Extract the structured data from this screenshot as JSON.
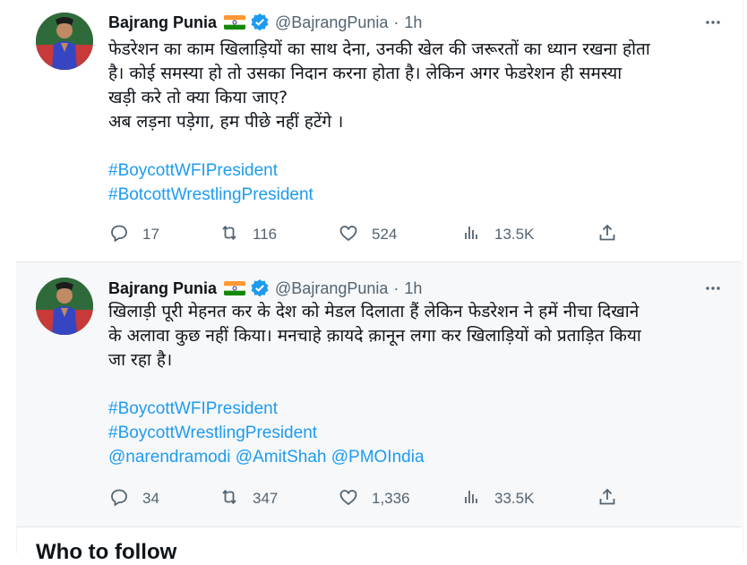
{
  "tweets": [
    {
      "author": "Bajrang Punia",
      "handle": "@BajrangPunia",
      "time": "1h",
      "text_lines": [
        "फेडरेशन का काम खिलाड़ियों का साथ देना, उनकी खेल की जरूरतों का ध्यान रखना होता",
        "है। कोई समस्या हो तो उसका निदान करना होता है। लेकिन अगर फेडरेशन ही समस्या",
        "खड़ी करे तो क्या किया जाए?",
        "अब लड़ना पड़ेगा, हम पीछे नहीं हटेंगे ।"
      ],
      "hashtags": [
        "#BoycottWFIPresident",
        "#BotcottWrestlingPresident"
      ],
      "replies": "17",
      "retweets": "116",
      "likes": "524",
      "views": "13.5K"
    },
    {
      "author": "Bajrang Punia",
      "handle": "@BajrangPunia",
      "time": "1h",
      "text_lines": [
        "खिलाड़ी पूरी मेहनत कर के देश को मेडल दिलाता हैं लेकिन फेडरेशन ने हमें नीचा दिखाने",
        "के अलावा कुछ नहीं किया। मनचाहे क़ायदे क़ानून लगा कर खिलाड़ियों को प्रताड़ित किया",
        "जा रहा है।"
      ],
      "hashtags": [
        "#BoycottWFIPresident",
        "#BoycottWrestlingPresident"
      ],
      "mentions": "@narendramodi @AmitShah @PMOIndia",
      "replies": "34",
      "retweets": "347",
      "likes": "1,336",
      "views": "33.5K"
    }
  ],
  "who_to_follow": "Who to follow",
  "icons": [
    "more-icon",
    "reply-icon",
    "retweet-icon",
    "like-icon",
    "views-icon",
    "share-icon",
    "verified-icon",
    "india-flag-icon"
  ],
  "colors": {
    "accent": "#1d9bf0",
    "secondary_text": "#536471"
  }
}
